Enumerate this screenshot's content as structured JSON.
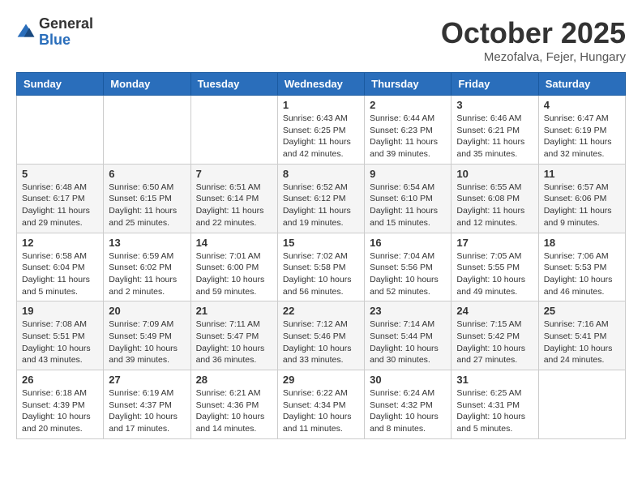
{
  "logo": {
    "general": "General",
    "blue": "Blue"
  },
  "title": "October 2025",
  "location": "Mezofalva, Fejer, Hungary",
  "weekdays": [
    "Sunday",
    "Monday",
    "Tuesday",
    "Wednesday",
    "Thursday",
    "Friday",
    "Saturday"
  ],
  "weeks": [
    [
      {
        "day": "",
        "info": ""
      },
      {
        "day": "",
        "info": ""
      },
      {
        "day": "",
        "info": ""
      },
      {
        "day": "1",
        "info": "Sunrise: 6:43 AM\nSunset: 6:25 PM\nDaylight: 11 hours\nand 42 minutes."
      },
      {
        "day": "2",
        "info": "Sunrise: 6:44 AM\nSunset: 6:23 PM\nDaylight: 11 hours\nand 39 minutes."
      },
      {
        "day": "3",
        "info": "Sunrise: 6:46 AM\nSunset: 6:21 PM\nDaylight: 11 hours\nand 35 minutes."
      },
      {
        "day": "4",
        "info": "Sunrise: 6:47 AM\nSunset: 6:19 PM\nDaylight: 11 hours\nand 32 minutes."
      }
    ],
    [
      {
        "day": "5",
        "info": "Sunrise: 6:48 AM\nSunset: 6:17 PM\nDaylight: 11 hours\nand 29 minutes."
      },
      {
        "day": "6",
        "info": "Sunrise: 6:50 AM\nSunset: 6:15 PM\nDaylight: 11 hours\nand 25 minutes."
      },
      {
        "day": "7",
        "info": "Sunrise: 6:51 AM\nSunset: 6:14 PM\nDaylight: 11 hours\nand 22 minutes."
      },
      {
        "day": "8",
        "info": "Sunrise: 6:52 AM\nSunset: 6:12 PM\nDaylight: 11 hours\nand 19 minutes."
      },
      {
        "day": "9",
        "info": "Sunrise: 6:54 AM\nSunset: 6:10 PM\nDaylight: 11 hours\nand 15 minutes."
      },
      {
        "day": "10",
        "info": "Sunrise: 6:55 AM\nSunset: 6:08 PM\nDaylight: 11 hours\nand 12 minutes."
      },
      {
        "day": "11",
        "info": "Sunrise: 6:57 AM\nSunset: 6:06 PM\nDaylight: 11 hours\nand 9 minutes."
      }
    ],
    [
      {
        "day": "12",
        "info": "Sunrise: 6:58 AM\nSunset: 6:04 PM\nDaylight: 11 hours\nand 5 minutes."
      },
      {
        "day": "13",
        "info": "Sunrise: 6:59 AM\nSunset: 6:02 PM\nDaylight: 11 hours\nand 2 minutes."
      },
      {
        "day": "14",
        "info": "Sunrise: 7:01 AM\nSunset: 6:00 PM\nDaylight: 10 hours\nand 59 minutes."
      },
      {
        "day": "15",
        "info": "Sunrise: 7:02 AM\nSunset: 5:58 PM\nDaylight: 10 hours\nand 56 minutes."
      },
      {
        "day": "16",
        "info": "Sunrise: 7:04 AM\nSunset: 5:56 PM\nDaylight: 10 hours\nand 52 minutes."
      },
      {
        "day": "17",
        "info": "Sunrise: 7:05 AM\nSunset: 5:55 PM\nDaylight: 10 hours\nand 49 minutes."
      },
      {
        "day": "18",
        "info": "Sunrise: 7:06 AM\nSunset: 5:53 PM\nDaylight: 10 hours\nand 46 minutes."
      }
    ],
    [
      {
        "day": "19",
        "info": "Sunrise: 7:08 AM\nSunset: 5:51 PM\nDaylight: 10 hours\nand 43 minutes."
      },
      {
        "day": "20",
        "info": "Sunrise: 7:09 AM\nSunset: 5:49 PM\nDaylight: 10 hours\nand 39 minutes."
      },
      {
        "day": "21",
        "info": "Sunrise: 7:11 AM\nSunset: 5:47 PM\nDaylight: 10 hours\nand 36 minutes."
      },
      {
        "day": "22",
        "info": "Sunrise: 7:12 AM\nSunset: 5:46 PM\nDaylight: 10 hours\nand 33 minutes."
      },
      {
        "day": "23",
        "info": "Sunrise: 7:14 AM\nSunset: 5:44 PM\nDaylight: 10 hours\nand 30 minutes."
      },
      {
        "day": "24",
        "info": "Sunrise: 7:15 AM\nSunset: 5:42 PM\nDaylight: 10 hours\nand 27 minutes."
      },
      {
        "day": "25",
        "info": "Sunrise: 7:16 AM\nSunset: 5:41 PM\nDaylight: 10 hours\nand 24 minutes."
      }
    ],
    [
      {
        "day": "26",
        "info": "Sunrise: 6:18 AM\nSunset: 4:39 PM\nDaylight: 10 hours\nand 20 minutes."
      },
      {
        "day": "27",
        "info": "Sunrise: 6:19 AM\nSunset: 4:37 PM\nDaylight: 10 hours\nand 17 minutes."
      },
      {
        "day": "28",
        "info": "Sunrise: 6:21 AM\nSunset: 4:36 PM\nDaylight: 10 hours\nand 14 minutes."
      },
      {
        "day": "29",
        "info": "Sunrise: 6:22 AM\nSunset: 4:34 PM\nDaylight: 10 hours\nand 11 minutes."
      },
      {
        "day": "30",
        "info": "Sunrise: 6:24 AM\nSunset: 4:32 PM\nDaylight: 10 hours\nand 8 minutes."
      },
      {
        "day": "31",
        "info": "Sunrise: 6:25 AM\nSunset: 4:31 PM\nDaylight: 10 hours\nand 5 minutes."
      },
      {
        "day": "",
        "info": ""
      }
    ]
  ]
}
